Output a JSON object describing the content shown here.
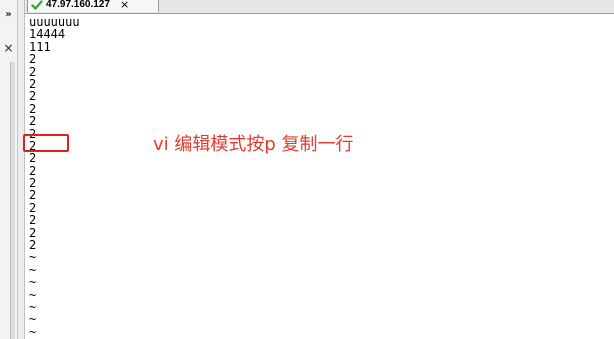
{
  "tab": {
    "title": "47.97.160.127",
    "close_glyph": "×",
    "status_icon": "check-icon"
  },
  "left_panel": {
    "pin_glyph": "»",
    "close_glyph": "×"
  },
  "terminal": {
    "lines": [
      "uuuuuuu",
      "14444",
      "111",
      "2",
      "2",
      "2",
      "2",
      "2",
      "2",
      "2",
      "2",
      "2",
      "2",
      "2",
      "2",
      "2",
      "2",
      "2",
      "2",
      "~",
      "~",
      "~",
      "~",
      "~",
      "~",
      "~"
    ]
  },
  "annotation": {
    "text": "vi 编辑模式按p 复制一行",
    "color": "#e53a2e"
  },
  "colors": {
    "highlight_box": "#e02020",
    "check_icon": "#3aa83a"
  }
}
